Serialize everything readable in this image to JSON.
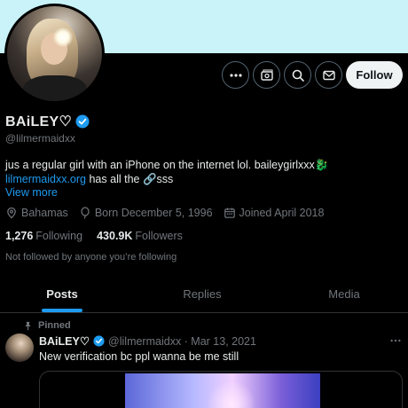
{
  "profile": {
    "display_name": "BAiLEY♡",
    "handle": "@lilmermaidxx",
    "bio_text": "jus a regular girl with an iPhone on the internet lol. baileygirlxxx🐉",
    "bio_link": "lilmermaidxx.org",
    "bio_link_suffix": "has all the 🔗sss",
    "view_more": "View more",
    "location": "Bahamas",
    "born": "Born December 5, 1996",
    "joined": "Joined April 2018",
    "following_count": "1,276",
    "following_label": "Following",
    "followers_count": "430.9K",
    "followers_label": "Followers",
    "not_followed_text": "Not followed by anyone you’re following"
  },
  "actions": {
    "follow_label": "Follow",
    "icons": [
      "more-icon",
      "subscribe-icon",
      "search-icon",
      "message-icon"
    ]
  },
  "tabs": [
    {
      "label": "Posts",
      "active": true
    },
    {
      "label": "Replies",
      "active": false
    },
    {
      "label": "Media",
      "active": false
    }
  ],
  "post": {
    "pinned_label": "Pinned",
    "name": "BAiLEY♡",
    "handle_date": "@lilmermaidxx · Mar 13, 2021",
    "text": "New verification bc ppl wanna be me still"
  },
  "colors": {
    "accent": "#1d9bf0",
    "banner": "#c9f3f8",
    "background": "#000000",
    "muted": "#71767b"
  }
}
